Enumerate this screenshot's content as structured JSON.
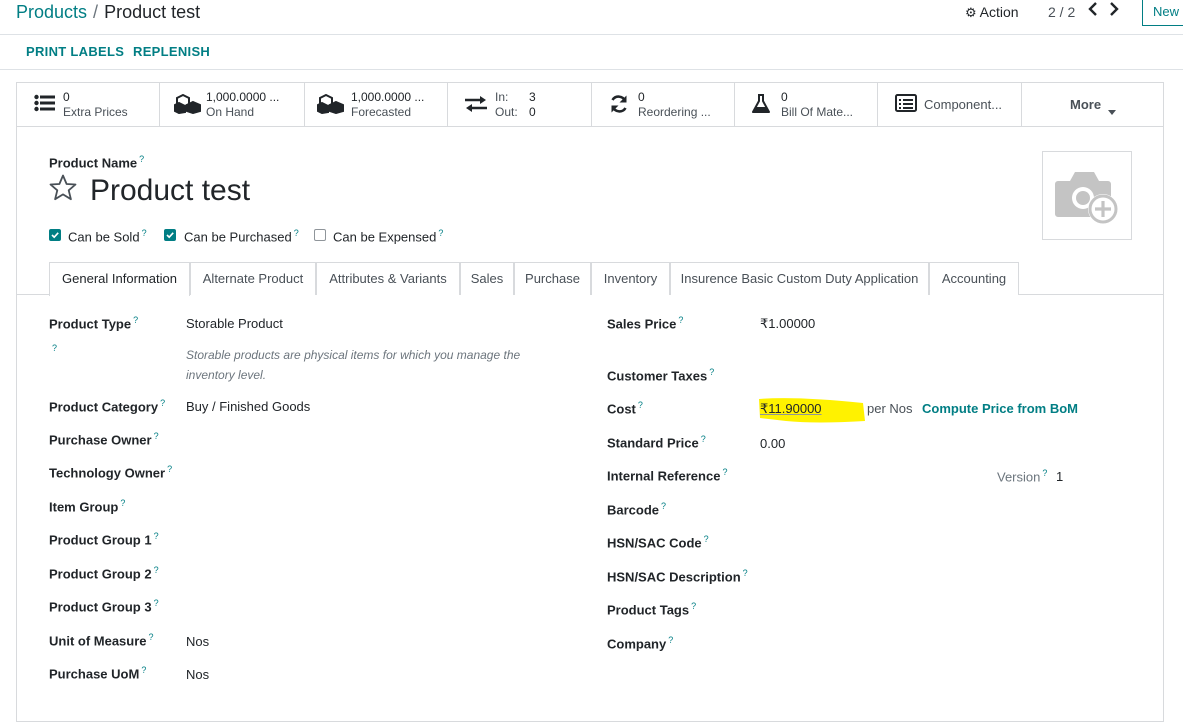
{
  "breadcrumb": {
    "parent": "Products",
    "separator": "/",
    "current": "Product test"
  },
  "control": {
    "action_label": "Action",
    "pager": "2 / 2",
    "new_label": "New"
  },
  "statusbar": {
    "print_labels": "PRINT LABELS",
    "replenish": "REPLENISH"
  },
  "smart_buttons": {
    "extra_prices": {
      "value": "0",
      "label": "Extra Prices",
      "icon": "list-icon"
    },
    "on_hand": {
      "value": "1,000.0000 ...",
      "label": "On Hand",
      "icon": "cubes-icon"
    },
    "forecasted": {
      "value": "1,000.0000 ...",
      "label": "Forecasted",
      "icon": "cubes-icon"
    },
    "in_out": {
      "in_label": "In:",
      "in_value": "3",
      "out_label": "Out:",
      "out_value": "0",
      "icon": "exchange-icon"
    },
    "reordering": {
      "value": "0",
      "label": "Reordering ...",
      "icon": "refresh-icon"
    },
    "bom": {
      "value": "0",
      "label": "Bill Of Mate...",
      "icon": "flask-icon"
    },
    "components": {
      "label": "Component...",
      "icon": "list-alt-icon"
    },
    "more": {
      "label": "More"
    }
  },
  "product": {
    "name_label": "Product Name",
    "name": "Product test",
    "checkboxes": [
      {
        "label": "Can be Sold",
        "checked": true
      },
      {
        "label": "Can be Purchased",
        "checked": true
      },
      {
        "label": "Can be Expensed",
        "checked": false
      }
    ]
  },
  "tabs": [
    "General Information",
    "Alternate Product",
    "Attributes & Variants",
    "Sales",
    "Purchase",
    "Inventory",
    "Insurence Basic Custom Duty Application",
    "Accounting"
  ],
  "left_fields": {
    "product_type": {
      "label": "Product Type",
      "value": "Storable Product"
    },
    "type_help": "Storable products are physical items for which you manage the inventory level.",
    "product_category": {
      "label": "Product Category",
      "value": "Buy / Finished Goods"
    },
    "purchase_owner": {
      "label": "Purchase Owner"
    },
    "technology_owner": {
      "label": "Technology Owner"
    },
    "item_group": {
      "label": "Item Group"
    },
    "product_group_1": {
      "label": "Product Group 1"
    },
    "product_group_2": {
      "label": "Product Group 2"
    },
    "product_group_3": {
      "label": "Product Group 3"
    },
    "uom": {
      "label": "Unit of Measure",
      "value": "Nos"
    },
    "purchase_uom": {
      "label": "Purchase UoM",
      "value": "Nos"
    }
  },
  "right_fields": {
    "sales_price": {
      "label": "Sales Price",
      "value": "₹1.00000"
    },
    "customer_taxes": {
      "label": "Customer Taxes"
    },
    "cost": {
      "label": "Cost",
      "value": "₹11.90000",
      "unit": "per Nos",
      "action": "Compute Price from BoM"
    },
    "standard_price": {
      "label": "Standard Price",
      "value": "0.00"
    },
    "internal_reference": {
      "label": "Internal Reference"
    },
    "version": {
      "label": "Version",
      "value": "1"
    },
    "barcode": {
      "label": "Barcode"
    },
    "hsn_code": {
      "label": "HSN/SAC Code"
    },
    "hsn_description": {
      "label": "HSN/SAC Description"
    },
    "product_tags": {
      "label": "Product Tags"
    },
    "company": {
      "label": "Company"
    }
  },
  "colors": {
    "accent": "#017e84",
    "highlight": "#fff200"
  }
}
